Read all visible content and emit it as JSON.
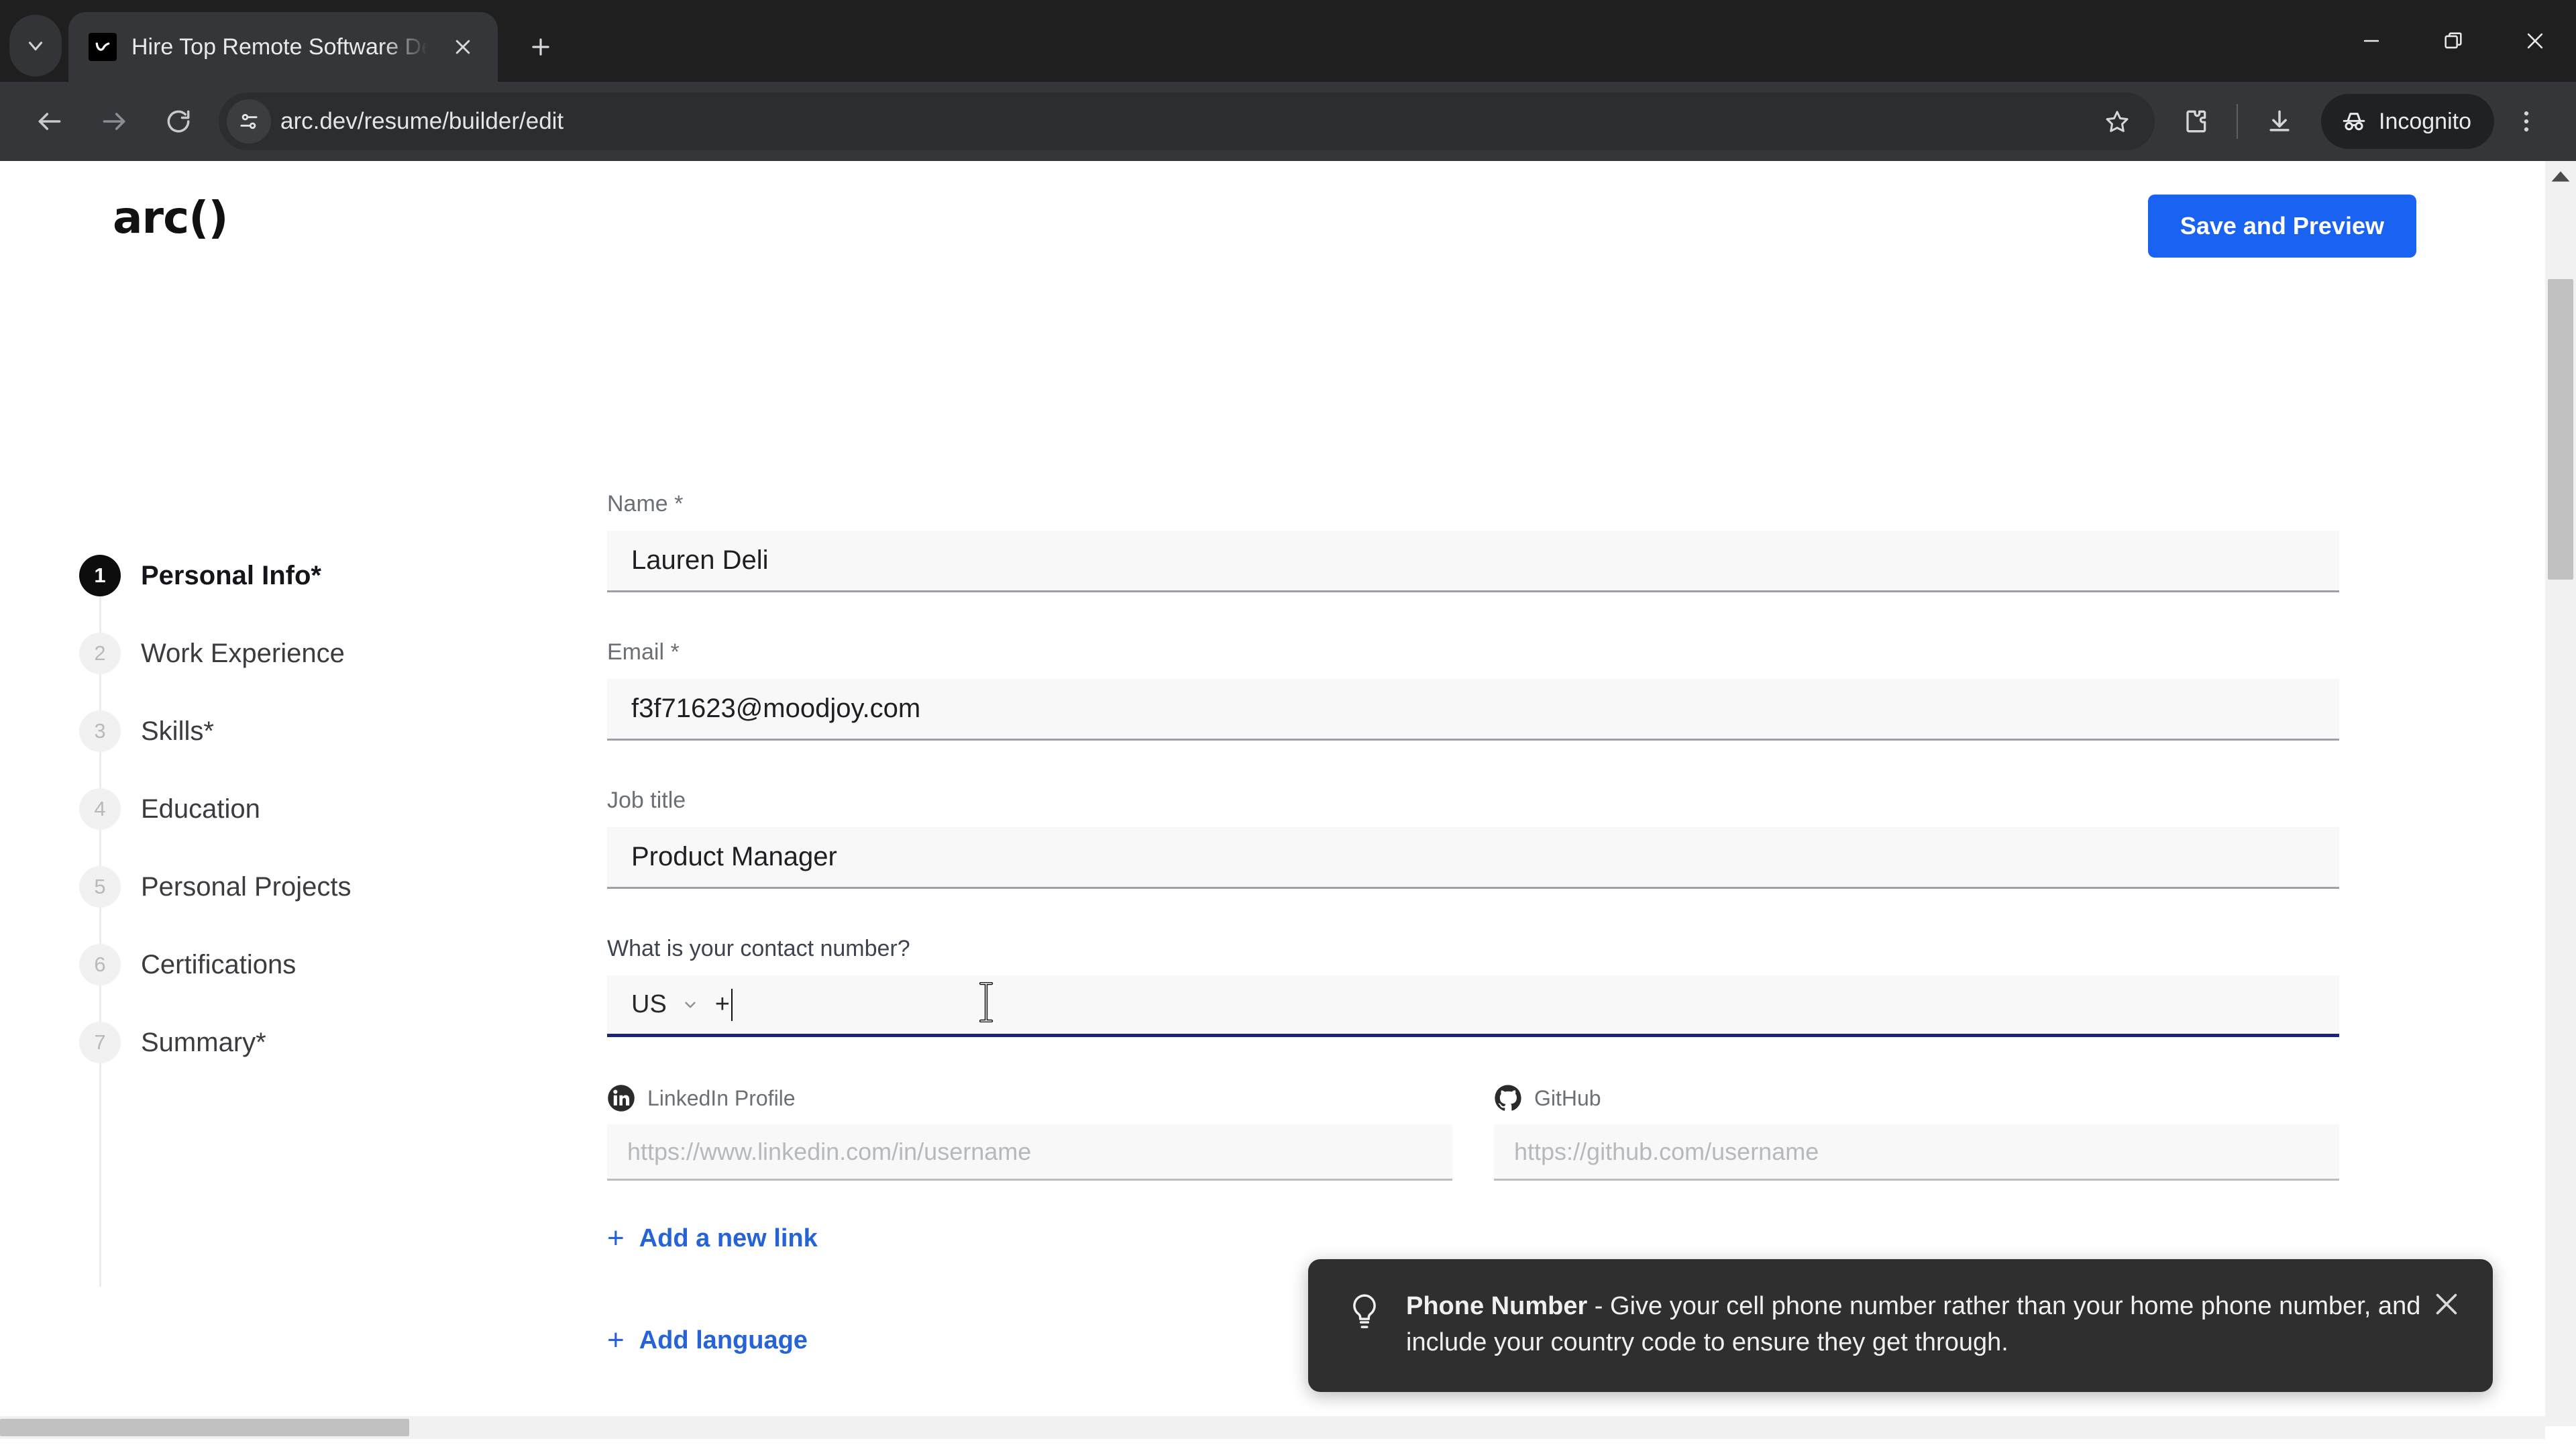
{
  "browser": {
    "tab": {
      "title": "Hire Top Remote Software Deve",
      "favicon": "arc-check-icon"
    },
    "omnibox": {
      "url": "arc.dev/resume/builder/edit"
    },
    "profile_pill": "Incognito"
  },
  "app": {
    "logo": "arc()",
    "save_button": "Save and Preview"
  },
  "sidebar": {
    "items": [
      {
        "num": "1",
        "label": "Personal Info*",
        "active": true
      },
      {
        "num": "2",
        "label": "Work Experience",
        "active": false
      },
      {
        "num": "3",
        "label": "Skills*",
        "active": false
      },
      {
        "num": "4",
        "label": "Education",
        "active": false
      },
      {
        "num": "5",
        "label": "Personal Projects",
        "active": false
      },
      {
        "num": "6",
        "label": "Certifications",
        "active": false
      },
      {
        "num": "7",
        "label": "Summary*",
        "active": false
      }
    ]
  },
  "form": {
    "name": {
      "label": "Name *",
      "value": "Lauren Deli",
      "placeholder": ""
    },
    "email": {
      "label": "Email *",
      "value": "f3f71623@moodjoy.com",
      "placeholder": ""
    },
    "job_title": {
      "label": "Job title",
      "value": "Product Manager",
      "placeholder": ""
    },
    "contact": {
      "label": "What is your contact number?",
      "country_code": "US",
      "prefix": "+",
      "value": "",
      "focused": true
    },
    "social": [
      {
        "icon": "linkedin-icon",
        "label": "LinkedIn Profile",
        "value": "",
        "placeholder": "https://www.linkedin.com/in/username"
      },
      {
        "icon": "github-icon",
        "label": "GitHub",
        "value": "",
        "placeholder": "https://github.com/username"
      }
    ],
    "add_link": "Add a new link",
    "add_language": "Add language",
    "plus": "+"
  },
  "toast": {
    "title": "Phone Number",
    "separator": " - ",
    "body": "Give your cell phone number rather than your home phone number, and include your country code to ensure they get through."
  },
  "colors": {
    "accent_blue": "#1a62f2",
    "link_blue": "#2563d6",
    "focus_underline": "#1a237e",
    "toast_bg": "#2f2f2f",
    "chrome_tabstrip": "#1f1f1f",
    "chrome_toolbar": "#35363a"
  }
}
